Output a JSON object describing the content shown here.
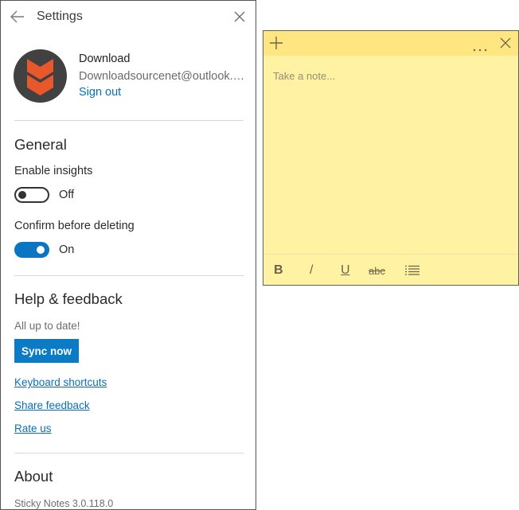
{
  "settings": {
    "title": "Settings",
    "back_icon": "back-arrow-icon",
    "close_icon": "close-icon",
    "account": {
      "name": "Download",
      "email": "Downloadsourcenet@outlook.com",
      "sign_out": "Sign out",
      "avatar_colors": {
        "background": "#414141",
        "chevrons": "#e9582a"
      }
    },
    "general": {
      "title": "General",
      "enable_insights": {
        "label": "Enable insights",
        "state": "Off",
        "on": false
      },
      "confirm_delete": {
        "label": "Confirm before deleting",
        "state": "On",
        "on": true
      }
    },
    "help": {
      "title": "Help & feedback",
      "status": "All up to date!",
      "sync_button": "Sync now",
      "links": [
        "Keyboard shortcuts",
        "Share feedback",
        "Rate us"
      ]
    },
    "about": {
      "title": "About",
      "version": "Sticky Notes 3.0.118.0"
    },
    "accent": "#0a7bc4"
  },
  "note": {
    "add_icon": "plus-icon",
    "menu_icon": "more-icon",
    "close_icon": "close-icon",
    "placeholder": "Take a note...",
    "toolbar": {
      "bold": "B",
      "italic": "/",
      "underline": "U",
      "strikethrough": "abc",
      "list_icon": "bullet-list-icon"
    },
    "colors": {
      "header": "#ffe680",
      "body": "#fff3a3"
    }
  }
}
